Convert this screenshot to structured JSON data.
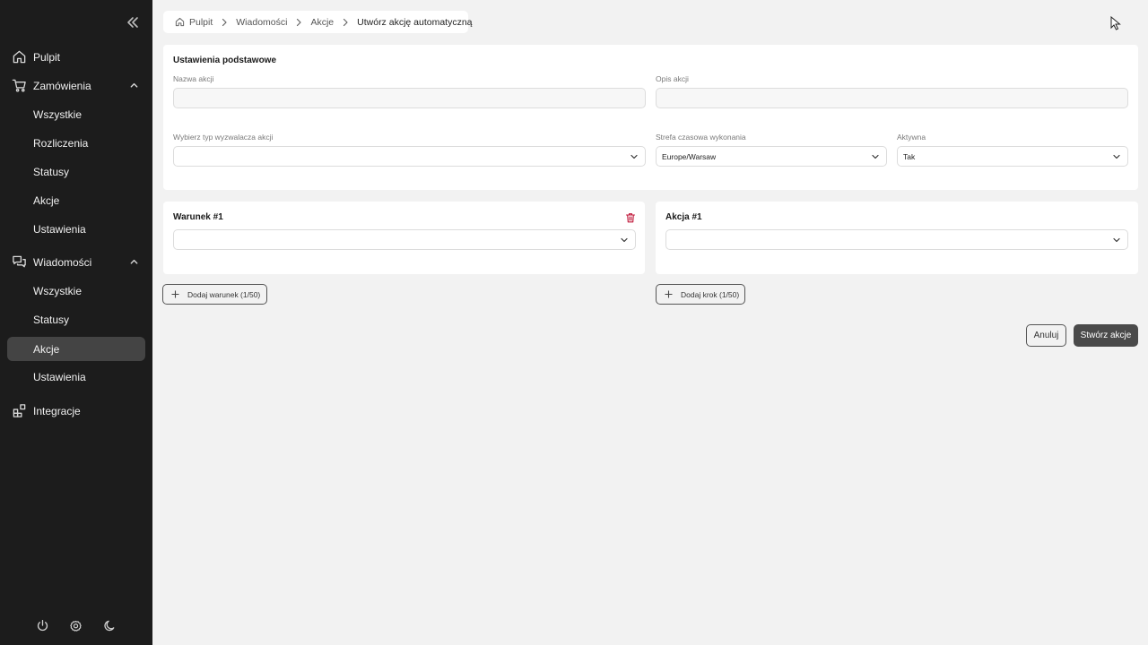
{
  "sidebar": {
    "items": [
      {
        "label": "Pulpit"
      },
      {
        "label": "Zamówienia"
      },
      {
        "label": "Wszystkie"
      },
      {
        "label": "Rozliczenia"
      },
      {
        "label": "Statusy"
      },
      {
        "label": "Akcje"
      },
      {
        "label": "Ustawienia"
      },
      {
        "label": "Wiadomości"
      },
      {
        "label": "Wszystkie"
      },
      {
        "label": "Statusy"
      },
      {
        "label": "Akcje"
      },
      {
        "label": "Ustawienia"
      },
      {
        "label": "Integracje"
      }
    ],
    "active_item": "Akcje"
  },
  "breadcrumb": {
    "items": [
      "Pulpit",
      "Wiadomości",
      "Akcje",
      "Utwórz akcję automatyczną"
    ]
  },
  "basic_settings": {
    "title": "Ustawienia podstawowe",
    "name_label": "Nazwa akcji",
    "name_value": "",
    "description_label": "Opis akcji",
    "description_value": "",
    "trigger_label": "Wybierz typ wyzwalacza akcji",
    "trigger_value": "",
    "timezone_label": "Strefa czasowa wykonania",
    "timezone_value": "Europe/Warsaw",
    "active_label": "Aktywna",
    "active_value": "Tak"
  },
  "condition": {
    "title": "Warunek #1",
    "value": "",
    "add_label": "Dodaj warunek (1/50)"
  },
  "action": {
    "title": "Akcja #1",
    "value": "",
    "add_label": "Dodaj krok (1/50)"
  },
  "footer": {
    "cancel_label": "Anuluj",
    "submit_label": "Stwórz akcje"
  },
  "colors": {
    "sidebar_bg": "#1c1c1c",
    "active_item_bg": "#444444",
    "page_bg": "#f2f2f2",
    "primary_button": "#4a4a4a",
    "delete_icon": "#c0183a"
  }
}
